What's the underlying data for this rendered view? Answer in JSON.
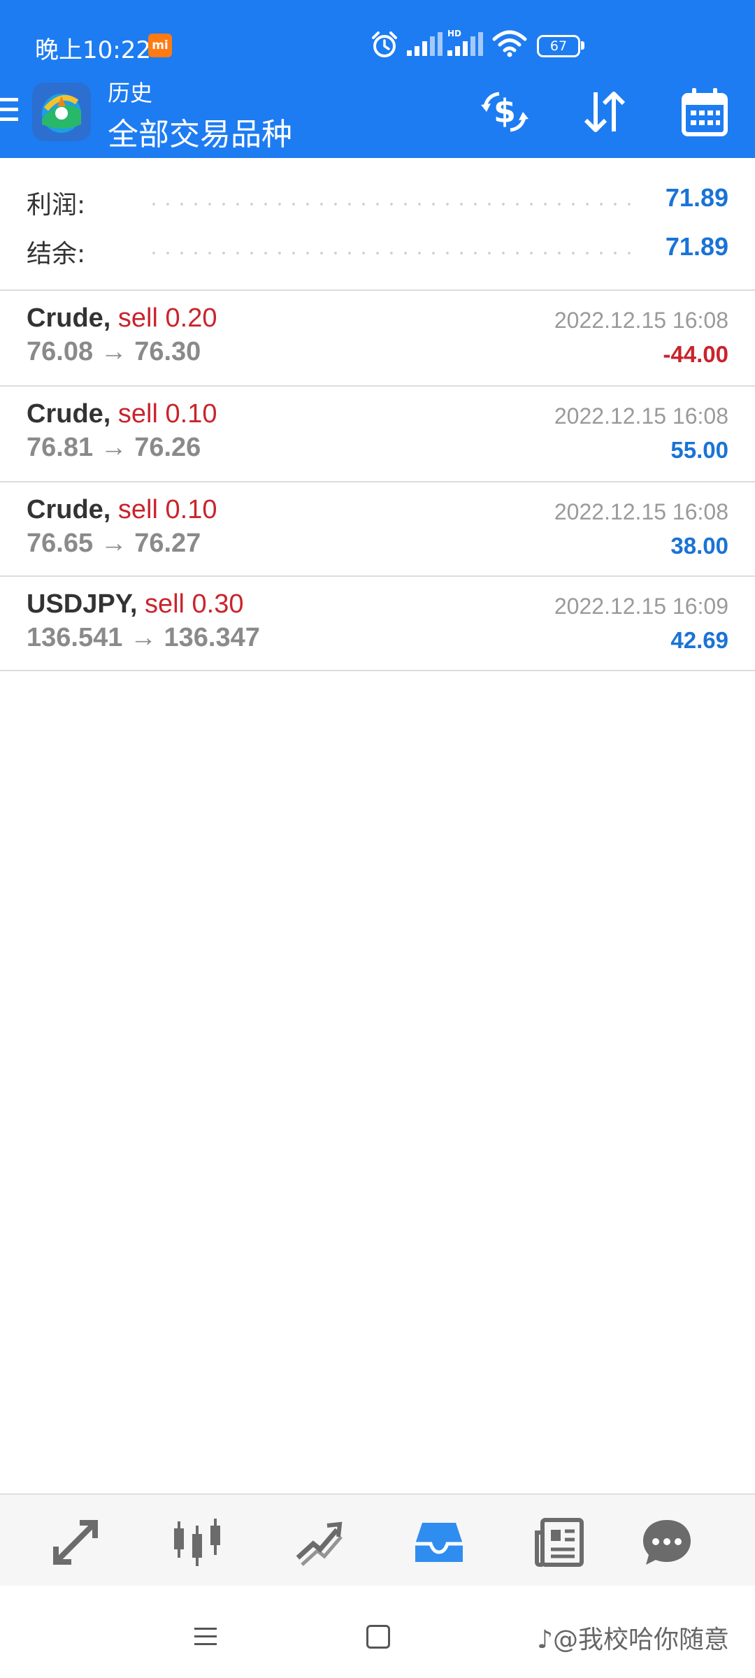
{
  "status_bar": {
    "time": "晚上10:22",
    "mi_badge": "mi",
    "battery": "67",
    "network_badge": "HD"
  },
  "header": {
    "subtitle": "历史",
    "title": "全部交易品种",
    "icons": [
      "menu-icon",
      "currency-exchange-icon",
      "sort-icon",
      "calendar-icon"
    ]
  },
  "summary": {
    "profit_label": "利润:",
    "profit_value": "71.89",
    "balance_label": "结余:",
    "balance_value": "71.89"
  },
  "trades": [
    {
      "symbol": "Crude,",
      "side": "sell 0.20",
      "open_price": "76.08",
      "close_price": "76.30",
      "time": "2022.12.15 16:08",
      "profit": "-44.00"
    },
    {
      "symbol": "Crude,",
      "side": "sell 0.10",
      "open_price": "76.81",
      "close_price": "76.26",
      "time": "2022.12.15 16:08",
      "profit": "55.00"
    },
    {
      "symbol": "Crude,",
      "side": "sell 0.10",
      "open_price": "76.65",
      "close_price": "76.27",
      "time": "2022.12.15 16:08",
      "profit": "38.00"
    },
    {
      "symbol": "USDJPY,",
      "side": "sell 0.30",
      "open_price": "136.541",
      "close_price": "136.347",
      "time": "2022.12.15 16:09",
      "profit": "42.69"
    }
  ],
  "arrow": "→",
  "bottom_nav": {
    "items": [
      "quotes-icon",
      "chart-candles-icon",
      "trade-icon",
      "history-inbox-icon",
      "news-icon",
      "chat-icon"
    ],
    "active_index": 3,
    "active_color": "#2f8df0",
    "inactive_color": "#6b6b6b"
  },
  "colors": {
    "header": "#1d7cf2",
    "profit_positive": "#1a73d6",
    "profit_negative": "#c9242c"
  },
  "watermark": "♪@我校哈你随意"
}
